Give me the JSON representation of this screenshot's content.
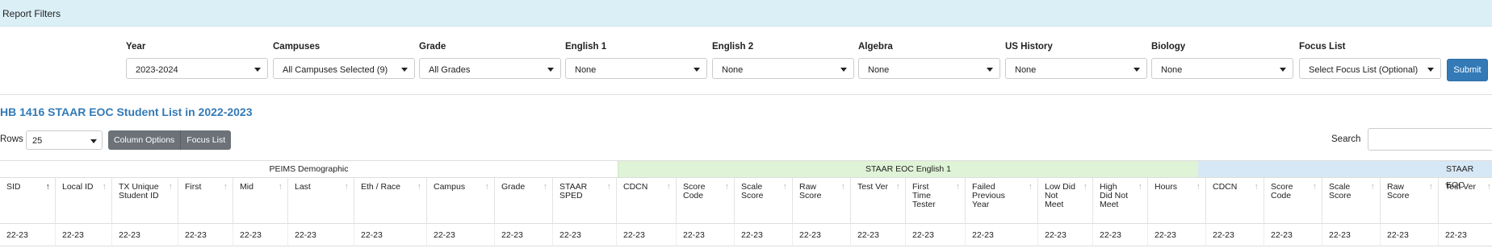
{
  "header": {
    "title": "Report Filters"
  },
  "filters": [
    {
      "label": "Year",
      "value": "2023-2024"
    },
    {
      "label": "Campuses",
      "value": "All Campuses Selected (9)"
    },
    {
      "label": "Grade",
      "value": "All Grades"
    },
    {
      "label": "English 1",
      "value": "None"
    },
    {
      "label": "English 2",
      "value": "None"
    },
    {
      "label": "Algebra",
      "value": "None"
    },
    {
      "label": "US History",
      "value": "None"
    },
    {
      "label": "Biology",
      "value": "None"
    },
    {
      "label": "Focus List",
      "value": "Select Focus List (Optional)"
    }
  ],
  "submit_label": "Submit",
  "list": {
    "title": "HB 1416 STAAR EOC Student List in 2022-2023",
    "rows_label": "Rows",
    "rows_value": "25",
    "column_options_label": "Column Options",
    "focus_list_label": "Focus List",
    "search_label": "Search"
  },
  "table": {
    "groups": [
      "PEIMS Demographic",
      "STAAR EOC English 1",
      "STAAR EOC"
    ],
    "columns": [
      "SID",
      "Local ID",
      "TX Unique Student ID",
      "First",
      "Mid",
      "Last",
      "Eth / Race",
      "Campus",
      "Grade",
      "STAAR SPED",
      "CDCN",
      "Score Code",
      "Scale Score",
      "Raw Score",
      "Test Ver",
      "First Time Tester",
      "Failed Previous Year",
      "Low Did Not Meet",
      "High Did Not Meet",
      "Hours",
      "CDCN",
      "Score Code",
      "Scale Score",
      "Raw Score",
      "Test Ver"
    ],
    "row": [
      "22-23",
      "22-23",
      "22-23",
      "22-23",
      "22-23",
      "22-23",
      "22-23",
      "22-23",
      "22-23",
      "22-23",
      "22-23",
      "22-23",
      "22-23",
      "22-23",
      "22-23",
      "22-23",
      "22-23",
      "22-23",
      "22-23",
      "22-23",
      "22-23",
      "22-23",
      "22-23",
      "22-23",
      "22-23"
    ]
  }
}
